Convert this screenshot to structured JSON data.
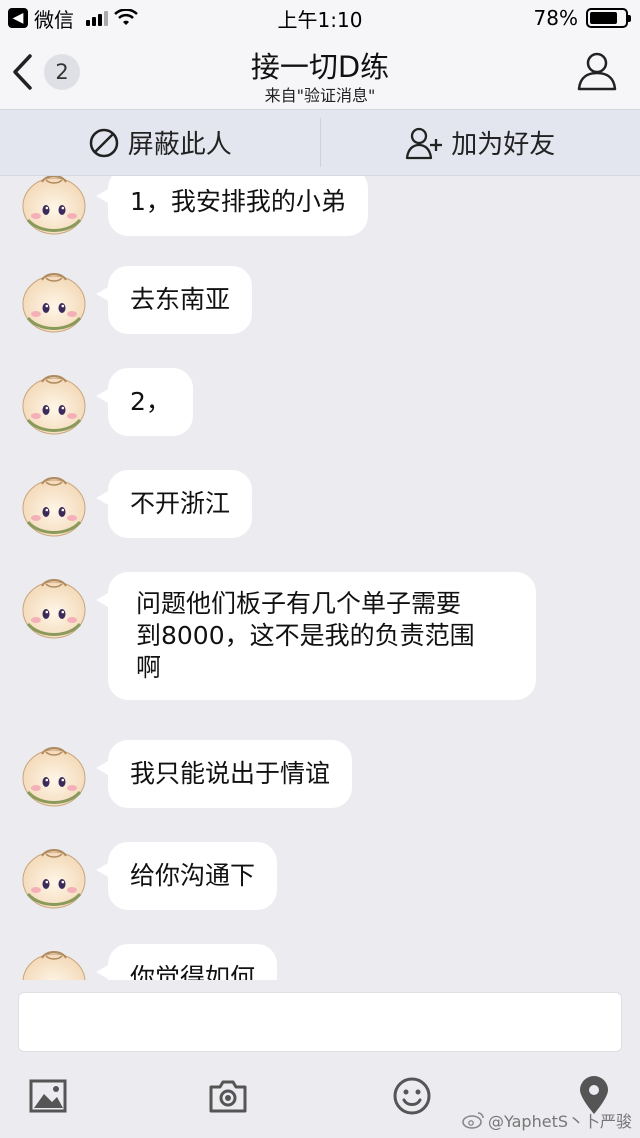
{
  "status_bar": {
    "back_app": "微信",
    "time": "上午1:10",
    "battery_percent": "78%",
    "battery_level": 0.78
  },
  "nav": {
    "back_count": "2",
    "title": "接一切D练",
    "subtitle": "来自\"验证消息\""
  },
  "actions": {
    "block": "屏蔽此人",
    "add_friend": "加为好友"
  },
  "messages": [
    {
      "text": "1，我安排我的小弟"
    },
    {
      "text": "去东南亚"
    },
    {
      "text": "2，"
    },
    {
      "text": "不开浙江"
    },
    {
      "text": "问题他们板子有几个单子需要\n到8000，这不是我的负责范围\n啊"
    },
    {
      "text": "我只能说出于情谊"
    },
    {
      "text": "给你沟通下"
    },
    {
      "text": "你觉得如何"
    }
  ],
  "watermark": "@YaphetS丶卜严骏",
  "icons": {
    "status_back": "back-arrow-icon",
    "wifi": "wifi-icon",
    "battery": "battery-icon",
    "nav_back": "chevron-left-icon",
    "profile": "person-icon",
    "block": "block-icon",
    "add_friend": "add-person-icon",
    "image": "image-icon",
    "camera": "camera-icon",
    "emoji": "emoji-icon",
    "location": "location-pin-icon",
    "weibo": "weibo-icon"
  }
}
